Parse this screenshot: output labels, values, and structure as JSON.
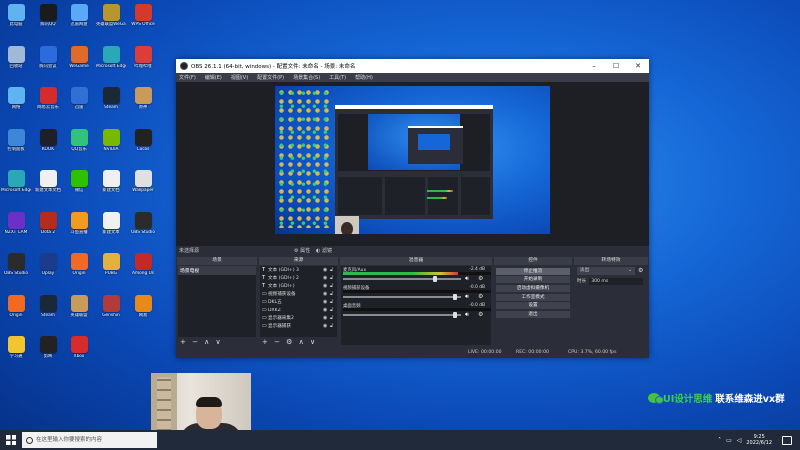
{
  "desktop": {
    "icons": [
      {
        "label": "此电脑",
        "color": "#5fb3f0"
      },
      {
        "label": "腾讯QQ",
        "color": "#1b1b1b"
      },
      {
        "label": "迅雷网盘",
        "color": "#5aa8f7"
      },
      {
        "label": "英雄联盟WeGame版",
        "color": "#b8962e"
      },
      {
        "label": "WPS Office",
        "color": "#d33a2c"
      },
      {
        "label": "回收站",
        "color": "#9fb9d6"
      },
      {
        "label": "腾讯会议",
        "color": "#2d6bdc"
      },
      {
        "label": "WeGame",
        "color": "#e06a28"
      },
      {
        "label": "Microsoft Edge",
        "color": "#2aa8b8"
      },
      {
        "label": "哔哩哔哩",
        "color": "#de3b3b"
      },
      {
        "label": "网络",
        "color": "#5fb3f0"
      },
      {
        "label": "网易云音乐",
        "color": "#d62b2b"
      },
      {
        "label": "迅雷",
        "color": "#2f6fd6"
      },
      {
        "label": "Steam",
        "color": "#1b2838"
      },
      {
        "label": "原神",
        "color": "#c89b5a"
      },
      {
        "label": "控制面板",
        "color": "#3d86d8"
      },
      {
        "label": "KOOK",
        "color": "#1f1f2a"
      },
      {
        "label": "QQ音乐",
        "color": "#31c27c"
      },
      {
        "label": "NVIDIA",
        "color": "#76b900"
      },
      {
        "label": "Cocos",
        "color": "#222"
      },
      {
        "label": "Microsoft Edge",
        "color": "#2aa8b8"
      },
      {
        "label": "新建文本文档",
        "color": "#f0f0f0"
      },
      {
        "label": "微信",
        "color": "#2dc100"
      },
      {
        "label": "新建文档",
        "color": "#f0f0f0"
      },
      {
        "label": "Wallpaper",
        "color": "#e0e0e0"
      },
      {
        "label": "NZXT CAM",
        "color": "#6c2fc8"
      },
      {
        "label": "Dota 2",
        "color": "#b52c1f"
      },
      {
        "label": "斗鱼直播",
        "color": "#f29c1f"
      },
      {
        "label": "新建文本",
        "color": "#f0f0f0"
      },
      {
        "label": "OBS Studio",
        "color": "#2b2b2b"
      },
      {
        "label": "OBS Studio",
        "color": "#2b2b2b"
      },
      {
        "label": "Uplay",
        "color": "#1b3c8a"
      },
      {
        "label": "Origin",
        "color": "#f26a21"
      },
      {
        "label": "PUBG",
        "color": "#e3b23c"
      },
      {
        "label": "Among Us",
        "color": "#c62828"
      },
      {
        "label": "Origin",
        "color": "#f26a21"
      },
      {
        "label": "Steam",
        "color": "#1b2838"
      },
      {
        "label": "英雄联盟",
        "color": "#c89b5a"
      },
      {
        "label": "Genshin",
        "color": "#b23a3a"
      },
      {
        "label": "网易",
        "color": "#e88a1a"
      },
      {
        "label": "学习通",
        "color": "#f0c530"
      },
      {
        "label": "剪映",
        "color": "#222"
      },
      {
        "label": "Xbox",
        "color": "#d82b2b"
      }
    ]
  },
  "obs": {
    "title": "OBS 26.1.1 (64-bit, windows) - 配置文件: 未命名 - 场景: 未命名",
    "menu": [
      "文件(F)",
      "编辑(E)",
      "视图(V)",
      "配置文件(P)",
      "场景集合(S)",
      "工具(T)",
      "帮助(H)"
    ],
    "scene_label": "未选择源",
    "props_label": "属性",
    "filters_label": "滤镜",
    "docks": {
      "scenes": {
        "title": "场景",
        "items": [
          "场景电视"
        ],
        "footer": "+ − ∧ ∨"
      },
      "sources": {
        "title": "来源",
        "items": [
          {
            "icon": "T",
            "name": "文本 (GDI+) 3"
          },
          {
            "icon": "T",
            "name": "文本 (GDI+) 2"
          },
          {
            "icon": "T",
            "name": "文本 (GDI+)"
          },
          {
            "icon": "▭",
            "name": "视频捕获设备"
          },
          {
            "icon": "▭",
            "name": "DKL五"
          },
          {
            "icon": "▭",
            "name": "DXKZ"
          },
          {
            "icon": "▭",
            "name": "显示器采集2"
          },
          {
            "icon": "▭",
            "name": "显示器捕获"
          }
        ],
        "footer": "+ − ⚙ ∧ ∨"
      },
      "mixer": {
        "title": "混音器",
        "channels": [
          {
            "name": "麦克风/Aux",
            "db": "-2.4 dB",
            "level": 0.78
          },
          {
            "name": "视频捕获设备",
            "db": "-0.0 dB",
            "level": 0.0
          },
          {
            "name": "桌面音频",
            "db": "-0.0 dB",
            "level": 0.0
          }
        ]
      },
      "controls": {
        "title": "控件",
        "buttons": [
          "停止推流",
          "开始录制",
          "启动虚拟摄像机",
          "工作室模式",
          "设置",
          "退出"
        ]
      },
      "transitions": {
        "title": "转场特效",
        "selected": "淡出",
        "duration_label": "时长",
        "duration": "300 ms"
      }
    },
    "status": {
      "live": "LIVE: 00:00:00",
      "rec": "REC: 00:00:00",
      "cpu": "CPU: 3.7%, 60.00 fps"
    }
  },
  "watermark": {
    "green": "UI设计思维",
    "white": "联系维森进vx群"
  },
  "taskbar": {
    "search_placeholder": "在这里输入你要搜索的内容",
    "time": "9:25",
    "date": "2022/6/12"
  },
  "colors": {
    "obs_bg": "#2b2e38",
    "accent_green": "#3ecf4a",
    "desktop_blue": "#1566d6"
  }
}
